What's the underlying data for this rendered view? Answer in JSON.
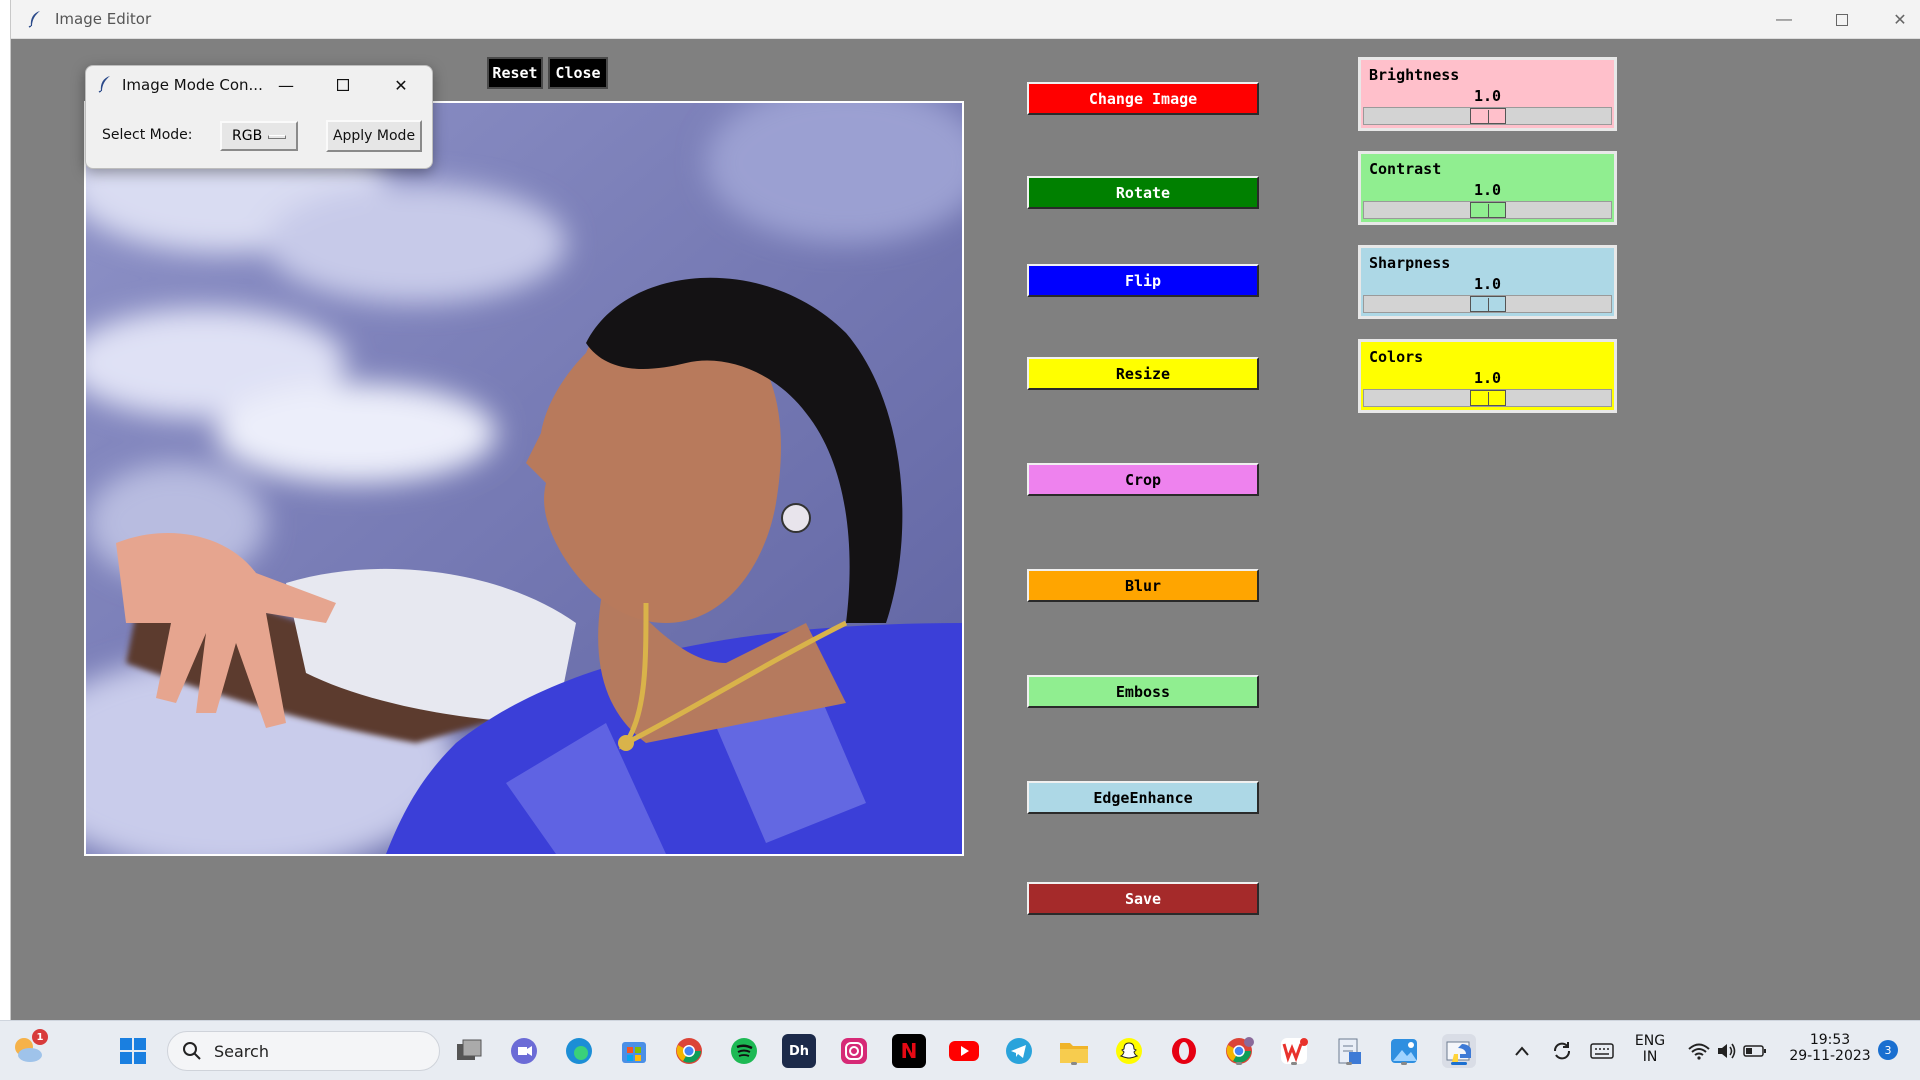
{
  "window": {
    "title": "Image Editor"
  },
  "top_buttons": {
    "reset": "Reset",
    "close": "Close"
  },
  "actions": [
    {
      "label": "Change Image",
      "bg": "#ff0000",
      "fg": "#ffffff"
    },
    {
      "label": "Rotate",
      "bg": "#008000",
      "fg": "#ffffff"
    },
    {
      "label": "Flip",
      "bg": "#0000ff",
      "fg": "#ffffff"
    },
    {
      "label": "Resize",
      "bg": "#ffff00",
      "fg": "#000000"
    },
    {
      "label": "Crop",
      "bg": "#ee82ee",
      "fg": "#000000"
    },
    {
      "label": "Blur",
      "bg": "#ffa500",
      "fg": "#000000"
    },
    {
      "label": "Emboss",
      "bg": "#90ee90",
      "fg": "#000000"
    },
    {
      "label": "EdgeEnhance",
      "bg": "#add8e6",
      "fg": "#000000"
    },
    {
      "label": "Save",
      "bg": "#a52a2a",
      "fg": "#ffffff"
    }
  ],
  "sliders": [
    {
      "label": "Brightness",
      "value": "1.0",
      "bg": "#ffc0cb"
    },
    {
      "label": "Contrast",
      "value": "1.0",
      "bg": "#90ee90"
    },
    {
      "label": "Sharpness",
      "value": "1.0",
      "bg": "#add8e6"
    },
    {
      "label": "Colors",
      "value": "1.0",
      "bg": "#ffff00"
    }
  ],
  "dialog": {
    "title": "Image Mode Con...",
    "select_label": "Select Mode:",
    "selected_mode": "RGB",
    "apply_label": "Apply Mode"
  },
  "taskbar": {
    "search_placeholder": "Search",
    "weather_badge": "1",
    "lang_line1": "ENG",
    "lang_line2": "IN",
    "time": "19:53",
    "date": "29-11-2023",
    "notification_count": "3"
  }
}
